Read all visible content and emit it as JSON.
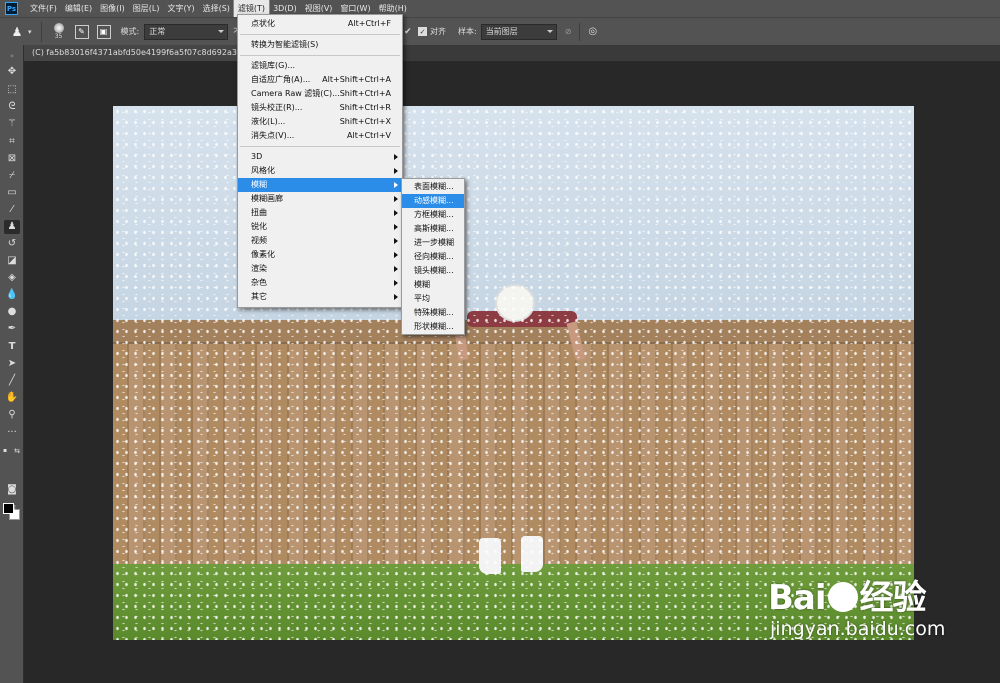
{
  "app": {
    "logo": "Ps"
  },
  "menubar": {
    "items": [
      "文件(F)",
      "编辑(E)",
      "图像(I)",
      "图层(L)",
      "文字(Y)",
      "选择(S)",
      "滤镜(T)",
      "3D(D)",
      "视图(V)",
      "窗口(W)",
      "帮助(H)"
    ],
    "active_index": 6
  },
  "options_bar": {
    "brush_size": "35",
    "mode_label": "模式:",
    "mode_value": "正常",
    "opacity_label_partial": "不",
    "align_label": "对齐",
    "sample_label": "样本:",
    "sample_value": "当前图层"
  },
  "document": {
    "tab_title": "(C) fa5b83016f4371abfd50e4199f6a5f07c8d692a3d59b"
  },
  "filter_menu": {
    "groups": [
      [
        {
          "label": "点状化",
          "shortcut": "Alt+Ctrl+F"
        }
      ],
      [
        {
          "label": "转换为智能滤镜(S)",
          "shortcut": ""
        }
      ],
      [
        {
          "label": "滤镜库(G)...",
          "shortcut": ""
        },
        {
          "label": "自适应广角(A)...",
          "shortcut": "Alt+Shift+Ctrl+A"
        },
        {
          "label": "Camera Raw 滤镜(C)...",
          "shortcut": "Shift+Ctrl+A"
        },
        {
          "label": "镜头校正(R)...",
          "shortcut": "Shift+Ctrl+R"
        },
        {
          "label": "液化(L)...",
          "shortcut": "Shift+Ctrl+X"
        },
        {
          "label": "消失点(V)...",
          "shortcut": "Alt+Ctrl+V"
        }
      ],
      [
        {
          "label": "3D",
          "sub": true
        },
        {
          "label": "风格化",
          "sub": true
        },
        {
          "label": "模糊",
          "sub": true,
          "highlighted": true
        },
        {
          "label": "模糊画廊",
          "sub": true
        },
        {
          "label": "扭曲",
          "sub": true
        },
        {
          "label": "锐化",
          "sub": true
        },
        {
          "label": "视频",
          "sub": true
        },
        {
          "label": "像素化",
          "sub": true
        },
        {
          "label": "渲染",
          "sub": true
        },
        {
          "label": "杂色",
          "sub": true
        },
        {
          "label": "其它",
          "sub": true
        }
      ]
    ]
  },
  "blur_submenu": {
    "items": [
      "表面模糊...",
      "动感模糊...",
      "方框模糊...",
      "高斯模糊...",
      "进一步模糊",
      "径向模糊...",
      "镜头模糊...",
      "模糊",
      "平均",
      "特殊模糊...",
      "形状模糊..."
    ],
    "highlighted_index": 1
  },
  "watermark": {
    "brand_left": "Bai",
    "brand_right": "经验",
    "url": "jingyan.baidu.com"
  },
  "colors": {
    "menu_highlight": "#2b8de7",
    "ui_panel": "#535353",
    "canvas_bg": "#282828"
  }
}
